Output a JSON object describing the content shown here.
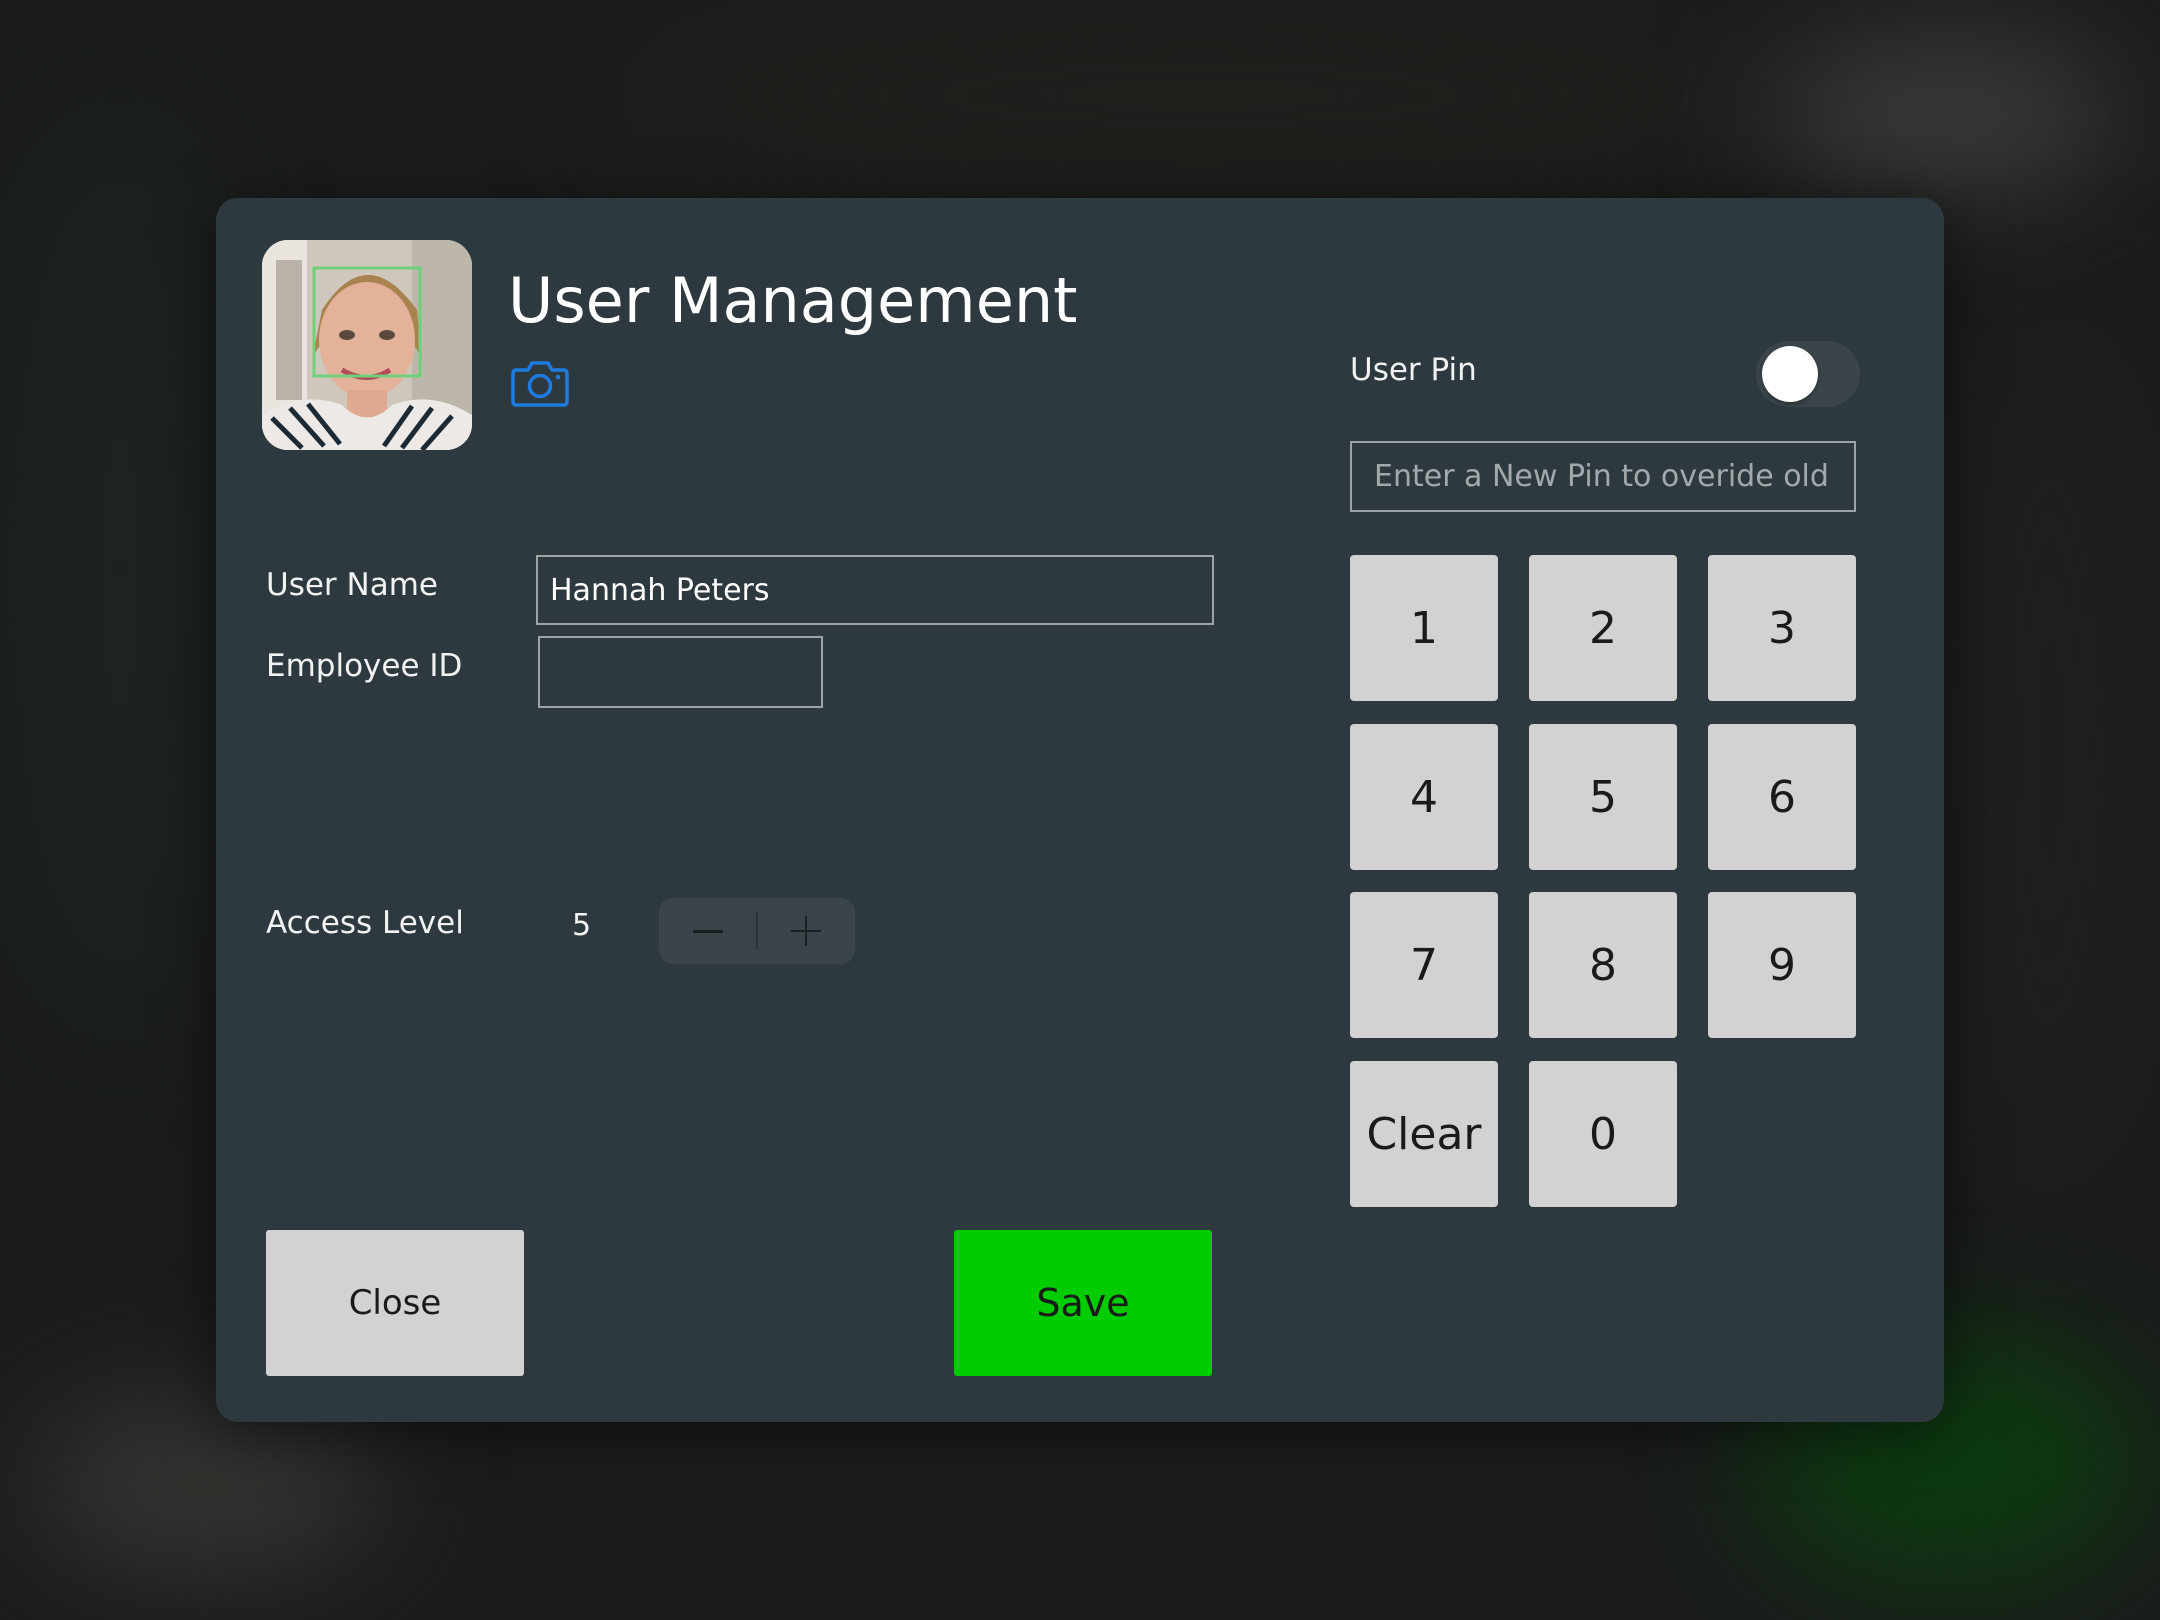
{
  "dialog": {
    "title": "User Management",
    "avatar_icon": "user-photo",
    "camera_icon": "camera-icon",
    "accent_color": "#1e7be0"
  },
  "form": {
    "user_name_label": "User Name",
    "user_name_value": "Hannah Peters",
    "employee_id_label": "Employee ID",
    "employee_id_value": "",
    "access_level_label": "Access Level",
    "access_level_value": "5"
  },
  "pin": {
    "label": "User Pin",
    "toggle_on": false,
    "placeholder": "Enter a New Pin to overide old Pin"
  },
  "keypad": {
    "keys": [
      "1",
      "2",
      "3",
      "4",
      "5",
      "6",
      "7",
      "8",
      "9",
      "Clear",
      "0"
    ]
  },
  "actions": {
    "close_label": "Close",
    "save_label": "Save",
    "save_color": "#00cc00"
  }
}
